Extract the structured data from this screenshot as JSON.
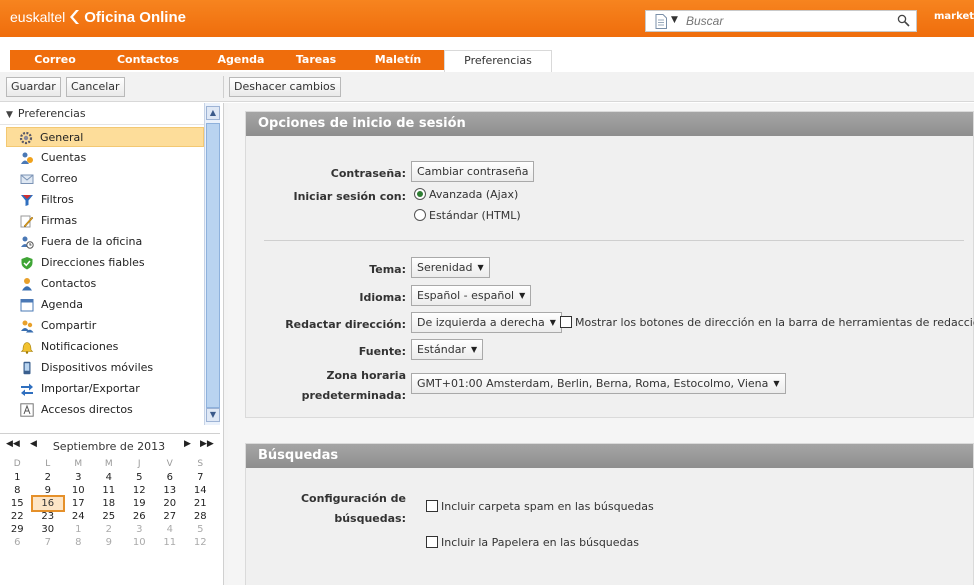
{
  "header": {
    "brand": "euskaltel",
    "product": "Oficina Online",
    "search_placeholder": "Buscar",
    "user": "marketi"
  },
  "tabs": [
    {
      "label": "Correo"
    },
    {
      "label": "Contactos"
    },
    {
      "label": "Agenda"
    },
    {
      "label": "Tareas"
    },
    {
      "label": "Maletín"
    },
    {
      "label": "Preferencias",
      "active": true
    }
  ],
  "toolbar": {
    "save": "Guardar",
    "cancel": "Cancelar",
    "undo": "Deshacer cambios"
  },
  "sidebar": {
    "root": "Preferencias",
    "items": [
      {
        "label": "General",
        "icon": "gear-icon",
        "selected": true
      },
      {
        "label": "Cuentas",
        "icon": "accounts-icon"
      },
      {
        "label": "Correo",
        "icon": "mail-icon"
      },
      {
        "label": "Filtros",
        "icon": "filter-icon"
      },
      {
        "label": "Firmas",
        "icon": "signature-icon"
      },
      {
        "label": "Fuera de la oficina",
        "icon": "out-of-office-icon"
      },
      {
        "label": "Direcciones fiables",
        "icon": "trusted-shield-icon"
      },
      {
        "label": "Contactos",
        "icon": "contacts-icon"
      },
      {
        "label": "Agenda",
        "icon": "calendar-icon"
      },
      {
        "label": "Compartir",
        "icon": "share-icon"
      },
      {
        "label": "Notificaciones",
        "icon": "bell-icon"
      },
      {
        "label": "Dispositivos móviles",
        "icon": "mobile-icon"
      },
      {
        "label": "Importar/Exportar",
        "icon": "import-export-icon"
      },
      {
        "label": "Accesos directos",
        "icon": "shortcut-icon"
      }
    ]
  },
  "calendar": {
    "month": "Septiembre de 2013",
    "weekdays": [
      "D",
      "L",
      "M",
      "M",
      "J",
      "V",
      "S"
    ],
    "today": "16",
    "weeks": [
      [
        "1",
        "2",
        "3",
        "4",
        "5",
        "6",
        "7"
      ],
      [
        "8",
        "9",
        "10",
        "11",
        "12",
        "13",
        "14"
      ],
      [
        "15",
        "16",
        "17",
        "18",
        "19",
        "20",
        "21"
      ],
      [
        "22",
        "23",
        "24",
        "25",
        "26",
        "27",
        "28"
      ],
      [
        "29",
        "30",
        "1",
        "2",
        "3",
        "4",
        "5"
      ],
      [
        "6",
        "7",
        "8",
        "9",
        "10",
        "11",
        "12"
      ]
    ]
  },
  "login_section": {
    "title": "Opciones de inicio de sesión",
    "password_label": "Contraseña:",
    "change_password": "Cambiar contraseña",
    "login_with_label": "Iniciar sesión con:",
    "option_advanced": "Avanzada (Ajax)",
    "option_standard": "Estándar (HTML)",
    "selected_option": "Avanzada (Ajax)",
    "theme_label": "Tema:",
    "theme_value": "Serenidad",
    "language_label": "Idioma:",
    "language_value": "Español - español",
    "compose_dir_label": "Redactar dirección:",
    "compose_dir_value": "De izquierda a derecha",
    "show_dir_buttons": "Mostrar los botones de dirección en la barra de herramientas de redacción",
    "font_label": "Fuente:",
    "font_value": "Estándar",
    "timezone_label_1": "Zona horaria",
    "timezone_label_2": "predeterminada:",
    "timezone_value": "GMT+01:00 Amsterdam, Berlin, Berna, Roma, Estocolmo, Viena"
  },
  "search_section": {
    "title": "Búsquedas",
    "config_label_1": "Configuración de",
    "config_label_2": "búsquedas:",
    "include_spam": "Incluir carpeta spam en las búsquedas",
    "include_trash": "Incluir la Papelera en las búsquedas"
  }
}
